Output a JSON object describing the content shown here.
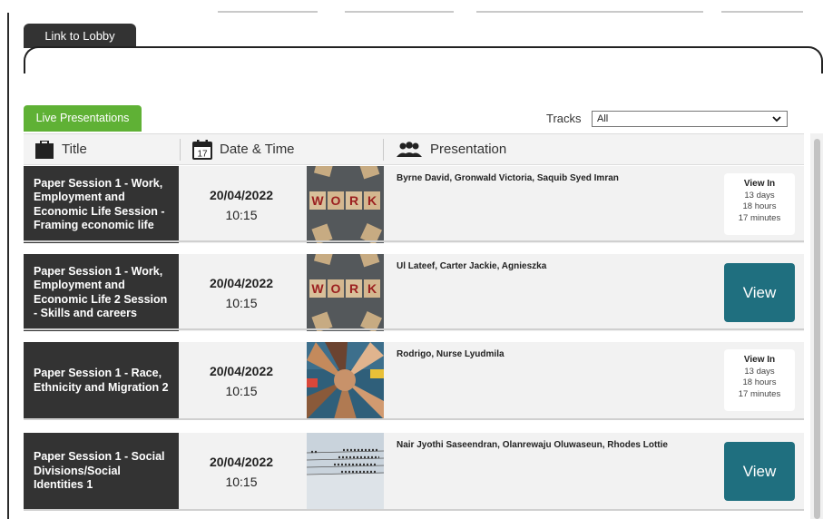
{
  "lobby_tab": {
    "label": "Link to Lobby"
  },
  "live_tab": {
    "label": "Live Presentations"
  },
  "tracks": {
    "label": "Tracks",
    "selected": "All"
  },
  "columns": {
    "title": "Title",
    "datetime": "Date & Time",
    "presentation": "Presentation"
  },
  "calendar_day": "17",
  "colors": {
    "accent_green": "#5fb135",
    "view_button": "#1f6f7f",
    "dark_cell": "#333333"
  },
  "sessions": [
    {
      "title": "Paper Session 1 - Work, Employment and Economic Life Session - Framing economic life",
      "date": "20/04/2022",
      "time": "10:15",
      "presenters": "Byrne David, Gronwald Victoria, Saquib Syed Imran",
      "thumbnail": "work-blocks-image",
      "action": "countdown",
      "view_in": "View In",
      "days": "13 days",
      "hours": "18 hours",
      "minutes": "17 minutes"
    },
    {
      "title": "Paper Session 1 - Work, Employment and Economic Life 2 Session - Skills and careers",
      "date": "20/04/2022",
      "time": "10:15",
      "presenters": "Ul Lateef, Carter Jackie, Agnieszka",
      "thumbnail": "work-blocks-image",
      "action": "view",
      "view_label": "View"
    },
    {
      "title": "Paper Session 1 - Race, Ethnicity and Migration 2",
      "date": "20/04/2022",
      "time": "10:15",
      "presenters": "Rodrigo, Nurse Lyudmila",
      "thumbnail": "stacked-hands-image",
      "action": "countdown",
      "view_in": "View In",
      "days": "13 days",
      "hours": "18 hours",
      "minutes": "17 minutes"
    },
    {
      "title": "Paper Session 1 - Social Divisions/Social Identities 1",
      "date": "20/04/2022",
      "time": "10:15",
      "presenters": "Nair Jyothi Saseendran, Olanrewaju Oluwaseun, Rhodes Lottie",
      "thumbnail": "birds-on-wires-image",
      "action": "view",
      "view_label": "View"
    }
  ]
}
